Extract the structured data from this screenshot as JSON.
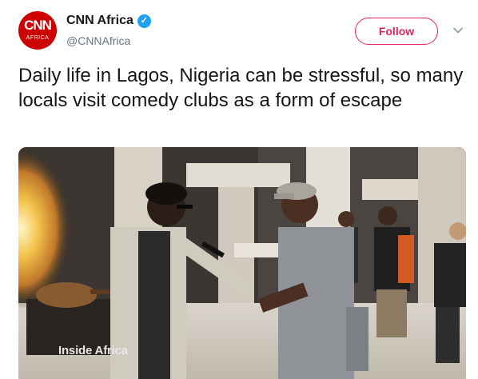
{
  "account": {
    "display_name": "CNN Africa",
    "handle": "@CNNAfrica",
    "verified": true,
    "avatar_logo": "CNN",
    "avatar_sub": "AFRICA"
  },
  "actions": {
    "follow_label": "Follow",
    "menu_icon": "chevron-down-icon"
  },
  "tweet": {
    "text": "Daily life in Lagos, Nigeria can be stressful, so many locals visit comedy clubs as a form of escape"
  },
  "media": {
    "watermark": "Inside Africa"
  },
  "colors": {
    "brand_red": "#cc0000",
    "follow_accent": "#e0245e",
    "verified_blue": "#1da1f2",
    "handle_gray": "#657786",
    "text": "#14171a"
  }
}
